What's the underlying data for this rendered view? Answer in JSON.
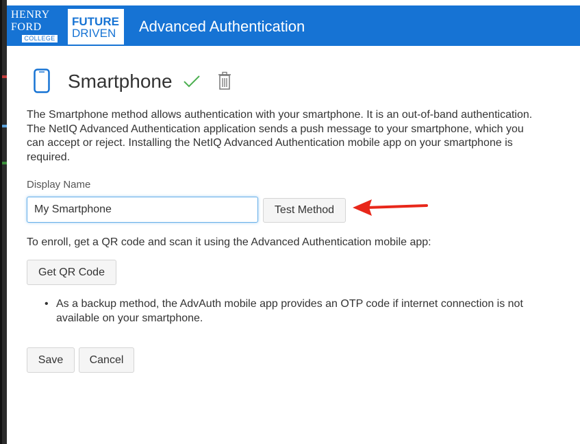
{
  "header": {
    "logo_henry": "HENRY",
    "logo_ford": "FORD",
    "logo_college": "COLLEGE",
    "logo_future": "FUTURE",
    "logo_driven": "DRIVEN",
    "title": "Advanced Authentication",
    "color": "#1673d4"
  },
  "method": {
    "icon": "smartphone-icon",
    "title": "Smartphone",
    "status_icon": "checkmark-icon",
    "delete_icon": "trash-icon",
    "description": "The Smartphone method allows authentication with your smartphone. It is an out-of-band authentication. The NetIQ Advanced Authentication application sends a push message to your smartphone, which you can accept or reject. Installing the NetIQ Advanced Authentication mobile app on your smartphone is required."
  },
  "form": {
    "display_name_label": "Display Name",
    "display_name_value": "My Smartphone",
    "test_method_label": "Test Method",
    "enroll_text": "To enroll, get a QR code and scan it using the Advanced Authentication mobile app:",
    "get_qr_label": "Get QR Code",
    "bullet": "•",
    "notes": [
      "As a backup method, the AdvAuth mobile app provides an OTP code if internet connection is not available on your smartphone."
    ],
    "save_label": "Save",
    "cancel_label": "Cancel"
  },
  "annotation": {
    "arrow_color": "#e8271a"
  },
  "colors": {
    "accent": "#1673d4",
    "check": "#4caf50",
    "text": "#333333"
  }
}
